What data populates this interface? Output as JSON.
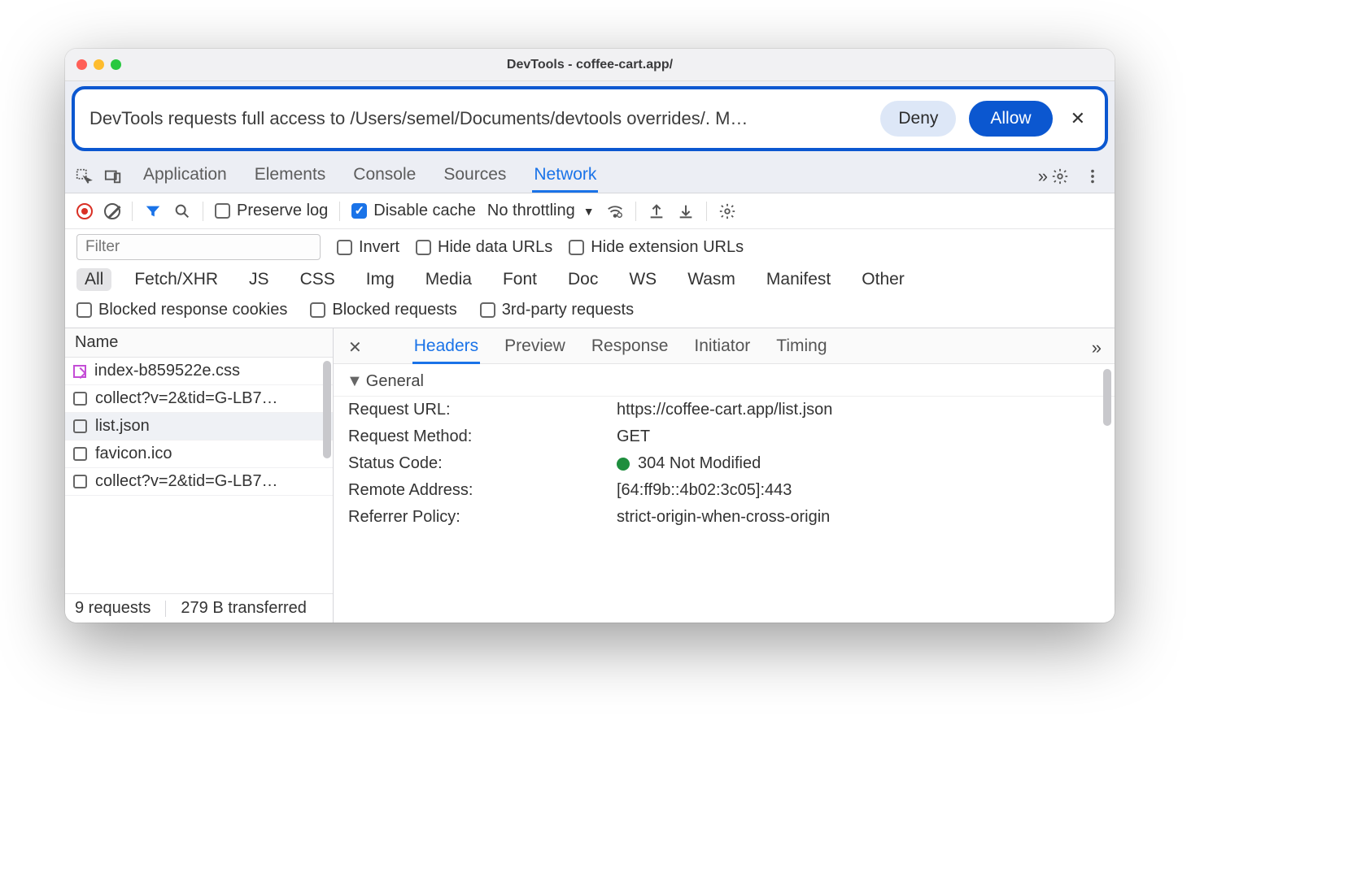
{
  "window": {
    "title": "DevTools - coffee-cart.app/"
  },
  "notice": {
    "text": "DevTools requests full access to /Users/semel/Documents/devtools overrides/. M…",
    "deny": "Deny",
    "allow": "Allow"
  },
  "tabs": {
    "items": [
      "Application",
      "Elements",
      "Console",
      "Sources",
      "Network"
    ],
    "activeIndex": 4
  },
  "toolbar": {
    "preserve_log": "Preserve log",
    "disable_cache": "Disable cache",
    "throttling": "No throttling"
  },
  "filters": {
    "placeholder": "Filter",
    "invert": "Invert",
    "hide_data_urls": "Hide data URLs",
    "hide_ext_urls": "Hide extension URLs"
  },
  "types": [
    "All",
    "Fetch/XHR",
    "JS",
    "CSS",
    "Img",
    "Media",
    "Font",
    "Doc",
    "WS",
    "Wasm",
    "Manifest",
    "Other"
  ],
  "blocked": {
    "cookies": "Blocked response cookies",
    "requests": "Blocked requests",
    "third_party": "3rd-party requests"
  },
  "requests": {
    "header": "Name",
    "items": [
      {
        "name": "index-b859522e.css",
        "override": true
      },
      {
        "name": "collect?v=2&tid=G-LB7…",
        "override": false
      },
      {
        "name": "list.json",
        "override": false,
        "selected": true
      },
      {
        "name": "favicon.ico",
        "override": false
      },
      {
        "name": "collect?v=2&tid=G-LB7…",
        "override": false
      }
    ],
    "status": {
      "count": "9 requests",
      "transferred": "279 B transferred"
    }
  },
  "detail": {
    "tabs": [
      "Headers",
      "Preview",
      "Response",
      "Initiator",
      "Timing"
    ],
    "activeIndex": 0,
    "general_label": "General",
    "general": [
      {
        "k": "Request URL:",
        "v": "https://coffee-cart.app/list.json"
      },
      {
        "k": "Request Method:",
        "v": "GET"
      },
      {
        "k": "Status Code:",
        "v": "304 Not Modified",
        "status_dot": true
      },
      {
        "k": "Remote Address:",
        "v": "[64:ff9b::4b02:3c05]:443"
      },
      {
        "k": "Referrer Policy:",
        "v": "strict-origin-when-cross-origin"
      }
    ]
  }
}
